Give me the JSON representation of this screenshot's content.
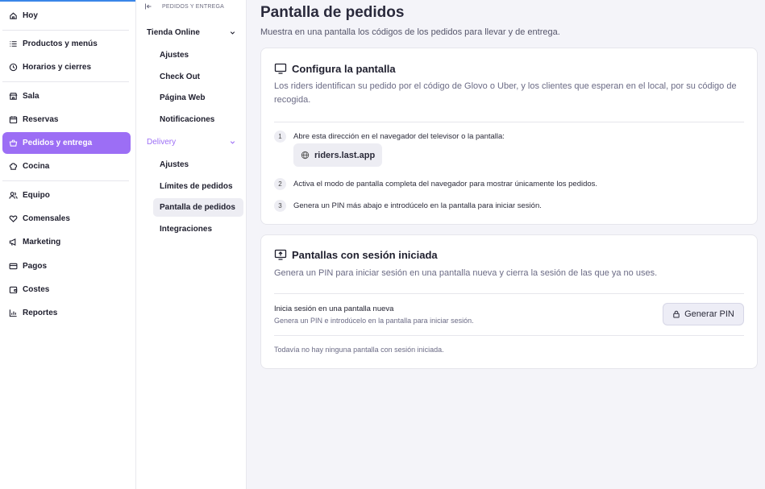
{
  "sidebar": {
    "items": [
      {
        "label": "Hoy",
        "icon": "home-icon"
      },
      {
        "label": "Productos y menús",
        "icon": "list-icon"
      },
      {
        "label": "Horarios y cierres",
        "icon": "clock-icon"
      },
      {
        "label": "Sala",
        "icon": "store-icon"
      },
      {
        "label": "Reservas",
        "icon": "calendar-icon"
      },
      {
        "label": "Pedidos y entrega",
        "icon": "basket-icon"
      },
      {
        "label": "Cocina",
        "icon": "chef-hat-icon"
      },
      {
        "label": "Equipo",
        "icon": "users-icon"
      },
      {
        "label": "Comensales",
        "icon": "heart-icon"
      },
      {
        "label": "Marketing",
        "icon": "megaphone-icon"
      },
      {
        "label": "Pagos",
        "icon": "card-icon"
      },
      {
        "label": "Costes",
        "icon": "wallet-icon"
      },
      {
        "label": "Reportes",
        "icon": "chart-icon"
      }
    ],
    "active_color": "#9c6ef5"
  },
  "subnav": {
    "header": "PEDIDOS Y ENTREGA",
    "group1": "Tienda Online",
    "group1_items": [
      "Ajustes",
      "Check Out",
      "Página Web",
      "Notificaciones"
    ],
    "group2": "Delivery",
    "group2_items": [
      "Ajustes",
      "Límites de pedidos",
      "Pantalla de pedidos",
      "Integraciones"
    ]
  },
  "main": {
    "title": "Pantalla de pedidos",
    "subtitle": "Muestra en una pantalla los códigos de los pedidos para llevar y de entrega.",
    "card1": {
      "title": "Configura la pantalla",
      "description": "Los riders identifican su pedido por el código de Glovo o Uber, y los clientes que esperan en el local, por su código de recogida.",
      "steps": [
        {
          "num": "1",
          "text": "Abre esta dirección en el navegador del televisor o la pantalla:"
        },
        {
          "num": "2",
          "text": "Activa el modo de pantalla completa del navegador para mostrar únicamente los pedidos."
        },
        {
          "num": "3",
          "text": "Genera un PIN más abajo e introdúcelo en la pantalla para iniciar sesión."
        }
      ],
      "url": "riders.last.app"
    },
    "card2": {
      "title": "Pantallas con sesión iniciada",
      "description": "Genera un PIN para iniciar sesión en una pantalla nueva y cierra la sesión de las que ya no uses.",
      "row_title": "Inicia sesión en una pantalla nueva",
      "row_sub": "Genera un PIN e introdúcelo en la pantalla para iniciar sesión.",
      "button": "Generar PIN",
      "empty": "Todavía no hay ninguna pantalla con sesión iniciada."
    }
  }
}
